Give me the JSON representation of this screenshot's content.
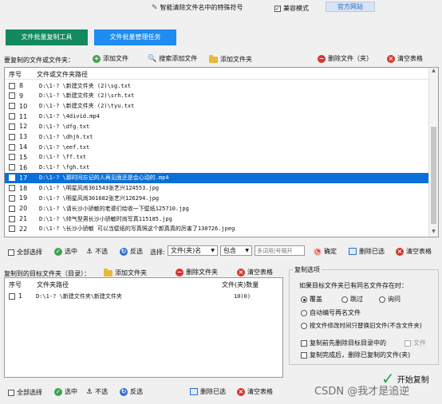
{
  "titlebar": {
    "toggle_label": "智能清除文件名中的特殊符号",
    "compat_label": "兼容模式",
    "site_label": "官方网站"
  },
  "tabs": {
    "tab1": "文件批量复制工具",
    "tab2": "文件批量管理任务"
  },
  "source": {
    "section_label": "要复制的文件或文件夹：",
    "add_file": "添加文件",
    "search_add": "搜索添加文件",
    "add_folder": "添加文件夹",
    "delete": "删除文件（夹）",
    "clear": "清空表格",
    "col_no": "序号",
    "col_path": "文件或文件夹路径",
    "rows": [
      {
        "no": "8",
        "path": "D:\\1-? \\新建文件夹 (2)\\sg.txt"
      },
      {
        "no": "9",
        "path": "D:\\1-? \\新建文件夹 (2)\\srh.txt"
      },
      {
        "no": "10",
        "path": "D:\\1-? \\新建文件夹 (2)\\tyu.txt"
      },
      {
        "no": "11",
        "path": "D:\\1-? \\4divid.mp4"
      },
      {
        "no": "12",
        "path": "D:\\1-? \\dfg.txt"
      },
      {
        "no": "13",
        "path": "D:\\1-? \\dhjh.txt"
      },
      {
        "no": "14",
        "path": "D:\\1-? \\eef.txt"
      },
      {
        "no": "15",
        "path": "D:\\1-? \\ff.txt"
      },
      {
        "no": "16",
        "path": "D:\\1-? \\fgh.txt"
      },
      {
        "no": "17",
        "path": "D:\\1-? \\那时间忘记的人再见面还是会心动的.mp4"
      },
      {
        "no": "18",
        "path": "D:\\1-? \\明星风尚301543张艺兴124553.jpg"
      },
      {
        "no": "19",
        "path": "D:\\1-? \\明星风尚301682张艺兴126294.jpg"
      },
      {
        "no": "20",
        "path": "D:\\1-? \\请长沙小骄敏的老婆们给收一下壁纸125710.jpg"
      },
      {
        "no": "21",
        "path": "D:\\1-? \\帅气型男长沙小骄敏时尚写真115185.jpg"
      },
      {
        "no": "22",
        "path": "D:\\1-? \\长沙小骄敏 可以当壁纸的写真照这个颜真真的厉害了130726.jpeg"
      }
    ],
    "toolbar": {
      "select_all": "全部选择",
      "selected": "选中",
      "unselect": "不选",
      "invert": "反选",
      "choose": "选择:",
      "type_value": "文件(夹)名",
      "mode_value": "包含",
      "input_placeholder": "多词用|号隔开",
      "confirm": "确定",
      "delete_selected": "删除已选",
      "clear": "清空表格"
    }
  },
  "target": {
    "section_label": "复制到的目标文件夹（目录）：",
    "add_folder": "添加文件夹",
    "delete": "删除文件夹",
    "clear": "清空表格",
    "col_no": "序号",
    "col_path": "文件夹路径",
    "col_count": "文件(夹)数量",
    "rows": [
      {
        "no": "1",
        "path": "D:\\1-? \\新建文件夹\\新建文件夹",
        "count": "10(0)"
      }
    ],
    "toolbar": {
      "select_all": "全部选择",
      "selected": "选中",
      "unselect": "不选",
      "invert": "反选",
      "delete_selected": "删除已选",
      "clear": "清空表格"
    }
  },
  "options": {
    "title": "复制选项",
    "prompt": "如果目标文件夹已有同名文件存在时：",
    "overwrite": "覆盖",
    "skip": "跳过",
    "ask": "询问",
    "auto_rename": "自动编号再名文件",
    "by_time": "按文件修改时间只替换旧文件(不含文件夹)",
    "clear_before": "复制前先删除目标目录中的",
    "files_only": "文件",
    "delete_after": "复制完成后，删除已复制的文件(夹)"
  },
  "start_label": "开始复制",
  "watermark": "CSDN @我才是追逆",
  "colors": {
    "tab1_bg": "#138a5e",
    "tab2_bg": "#1e8cf0",
    "selection": "#0a6fd6",
    "green_check": "#2aa845"
  }
}
